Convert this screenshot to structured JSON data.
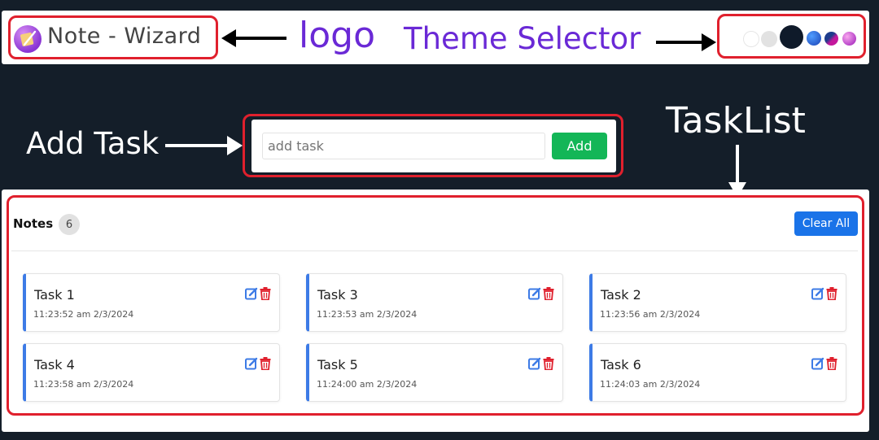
{
  "header": {
    "app_title": "Note - Wizard",
    "theme_options": [
      "white",
      "light-gray",
      "navy",
      "blue",
      "blue-purple",
      "purple-pink"
    ]
  },
  "annotations": {
    "logo": "logo",
    "theme_selector": "Theme Selector",
    "add_task": "Add Task",
    "task_list": "TaskList"
  },
  "add_task": {
    "placeholder": "add task",
    "value": "",
    "button_label": "Add"
  },
  "notes": {
    "title": "Notes",
    "count": "6",
    "clear_label": "Clear All",
    "items": [
      {
        "title": "Task 1",
        "time": "11:23:52 am 2/3/2024"
      },
      {
        "title": "Task 3",
        "time": "11:23:53 am 2/3/2024"
      },
      {
        "title": "Task 2",
        "time": "11:23:56 am 2/3/2024"
      },
      {
        "title": "Task 4",
        "time": "11:23:58 am 2/3/2024"
      },
      {
        "title": "Task 5",
        "time": "11:24:00 am 2/3/2024"
      },
      {
        "title": "Task 6",
        "time": "11:24:03 am 2/3/2024"
      }
    ]
  },
  "colors": {
    "background": "#141e29",
    "annotation_purple": "#6a29d6",
    "highlight_red": "#e0202d",
    "add_green": "#13b657",
    "clear_blue": "#1a73e8",
    "edit_blue": "#3d7be6",
    "delete_red": "#e0202d"
  }
}
